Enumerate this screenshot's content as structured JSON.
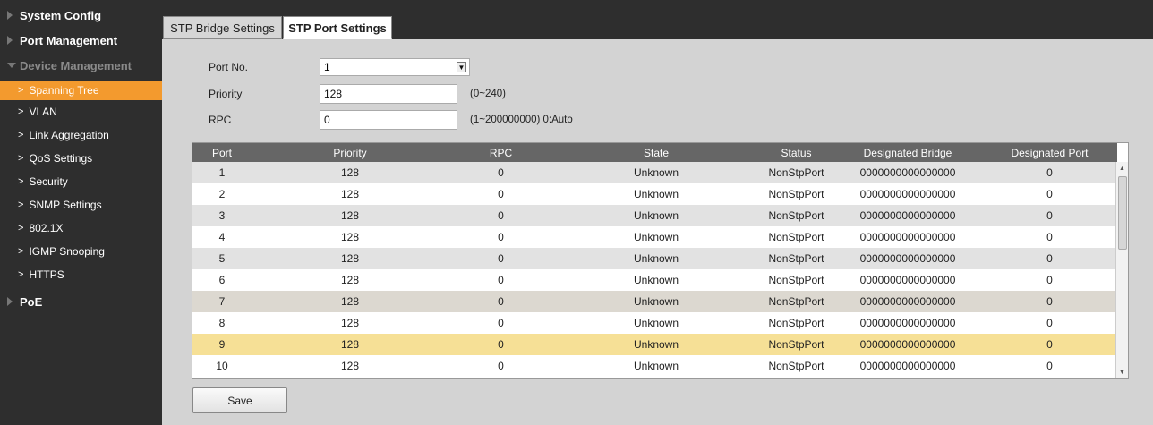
{
  "sidebar": {
    "system_config": "System Config",
    "port_management": "Port Management",
    "device_management": "Device Management",
    "items": [
      {
        "label": "Spanning Tree",
        "name": "spanning-tree",
        "active": true
      },
      {
        "label": "VLAN",
        "name": "vlan"
      },
      {
        "label": "Link Aggregation",
        "name": "link-aggregation"
      },
      {
        "label": "QoS Settings",
        "name": "qos-settings"
      },
      {
        "label": "Security",
        "name": "security"
      },
      {
        "label": "SNMP Settings",
        "name": "snmp-settings"
      },
      {
        "label": "802.1X",
        "name": "8021x"
      },
      {
        "label": "IGMP Snooping",
        "name": "igmp-snooping"
      },
      {
        "label": "HTTPS",
        "name": "https"
      }
    ],
    "poe": "PoE"
  },
  "tabs": {
    "bridge": "STP Bridge Settings",
    "port": "STP Port Settings"
  },
  "form": {
    "port_no_label": "Port No.",
    "port_no_value": "1",
    "priority_label": "Priority",
    "priority_value": "128",
    "priority_hint": "(0~240)",
    "rpc_label": "RPC",
    "rpc_value": "0",
    "rpc_hint": "(1~200000000) 0:Auto"
  },
  "table": {
    "headers": [
      "Port",
      "Priority",
      "RPC",
      "State",
      "Status",
      "Designated Bridge",
      "Designated Port"
    ],
    "rows": [
      [
        "1",
        "128",
        "0",
        "Unknown",
        "NonStpPort",
        "0000000000000000",
        "0"
      ],
      [
        "2",
        "128",
        "0",
        "Unknown",
        "NonStpPort",
        "0000000000000000",
        "0"
      ],
      [
        "3",
        "128",
        "0",
        "Unknown",
        "NonStpPort",
        "0000000000000000",
        "0"
      ],
      [
        "4",
        "128",
        "0",
        "Unknown",
        "NonStpPort",
        "0000000000000000",
        "0"
      ],
      [
        "5",
        "128",
        "0",
        "Unknown",
        "NonStpPort",
        "0000000000000000",
        "0"
      ],
      [
        "6",
        "128",
        "0",
        "Unknown",
        "NonStpPort",
        "0000000000000000",
        "0"
      ],
      [
        "7",
        "128",
        "0",
        "Unknown",
        "NonStpPort",
        "0000000000000000",
        "0"
      ],
      [
        "8",
        "128",
        "0",
        "Unknown",
        "NonStpPort",
        "0000000000000000",
        "0"
      ],
      [
        "9",
        "128",
        "0",
        "Unknown",
        "NonStpPort",
        "0000000000000000",
        "0"
      ],
      [
        "10",
        "128",
        "0",
        "Unknown",
        "NonStpPort",
        "0000000000000000",
        "0"
      ]
    ],
    "selected_row": 9
  },
  "save_label": "Save",
  "colors": {
    "sidebar_bg": "#2e2e2e",
    "active_item": "#f39a2e",
    "header_bg": "#666666",
    "selected_row": "#f6e096"
  }
}
